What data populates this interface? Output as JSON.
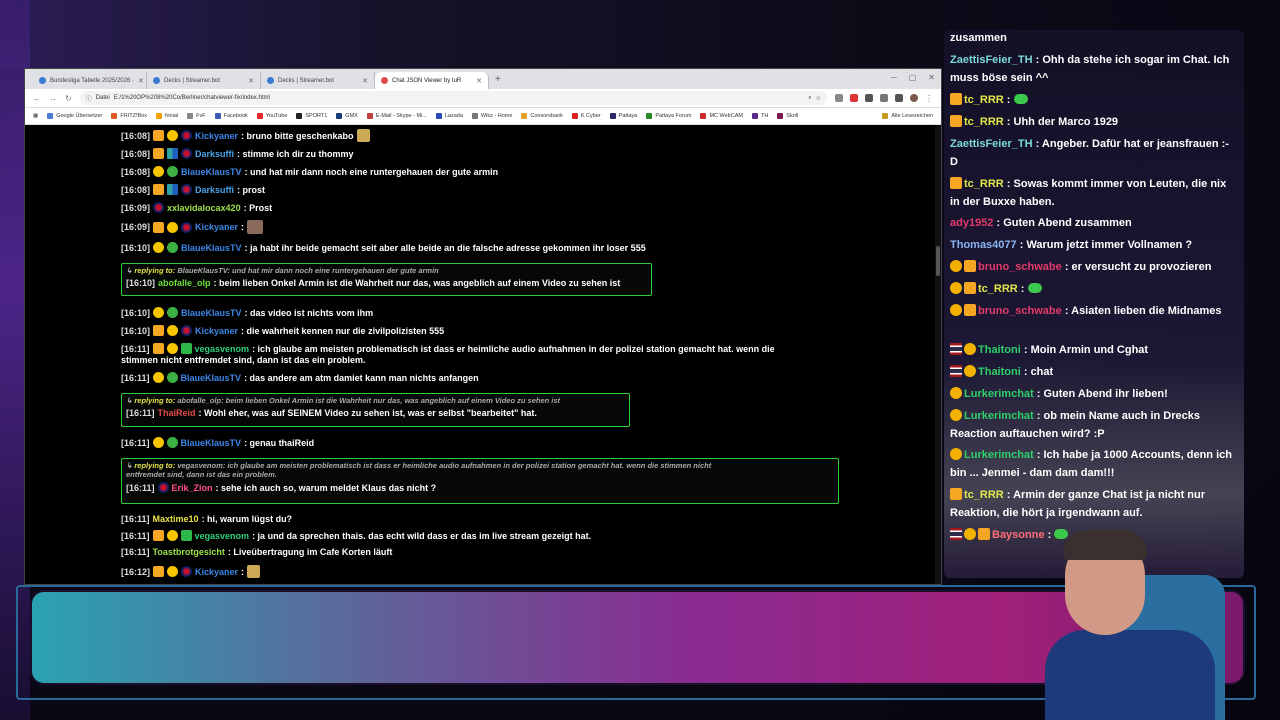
{
  "browser": {
    "tabs": [
      {
        "label": "Bundesliga Tabelle 2025/2026 ·"
      },
      {
        "label": "Decks | Streamer.bot"
      },
      {
        "label": "Decks | Streamer.bot"
      },
      {
        "label": "Chat JSON Viewer by tuR"
      }
    ],
    "new_tab": "+",
    "url_prefix": "Datei",
    "url": "E:/1%20OP%208%20Co/Berliner/chatviewer-fix/index.html",
    "bookmarks": [
      {
        "label": "Google Übersetzer"
      },
      {
        "label": "FRITZ!Box"
      },
      {
        "label": "fonial"
      },
      {
        "label": "FvF"
      },
      {
        "label": "Facebook"
      },
      {
        "label": "YouTube"
      },
      {
        "label": "SPORT1"
      },
      {
        "label": "GMX"
      },
      {
        "label": "E-Mail - Skype - Mi..."
      },
      {
        "label": "Lazada"
      },
      {
        "label": "Wikz - Home"
      },
      {
        "label": "Consorsbank"
      },
      {
        "label": "K Cyber"
      },
      {
        "label": "Pattaya"
      },
      {
        "label": "Pattaya Forum"
      },
      {
        "label": "MC WebCAM"
      },
      {
        "label": "TH"
      },
      {
        "label": "Skrill"
      }
    ],
    "bookmarks_right": "Alle Lesezeichen"
  },
  "chat": [
    {
      "ts": "[16:08]",
      "user": "Kickyaner",
      "text": ": bruno bitte geschenkabo"
    },
    {
      "ts": "[16:08]",
      "user": "Darksuffi",
      "text": ": stimme ich dir zu thommy"
    },
    {
      "ts": "[16:08]",
      "user": "BlaueKlausTV",
      "text": ": und hat mir dann noch eine runtergehauen der gute armin"
    },
    {
      "ts": "[16:08]",
      "user": "Darksuffi",
      "text": ": prost"
    },
    {
      "ts": "[16:09]",
      "user": "xxlavidalocax420",
      "text": ": Prost"
    },
    {
      "ts": "[16:09]",
      "user": "Kickyaner",
      "text": ":"
    },
    {
      "ts": "[16:10]",
      "user": "BlaueKlausTV",
      "text": ": ja habt ihr beide gemacht seit aber alle beide an die falsche adresse gekommen ihr loser 555"
    },
    {
      "ts": "[16:10]",
      "user": "BlaueKlausTV",
      "text": ": das video ist nichts vom ihm"
    },
    {
      "ts": "[16:10]",
      "user": "Kickyaner",
      "text": ": die wahrheit kennen nur die zivilpolizisten 555"
    },
    {
      "ts": "[16:11]",
      "user": "vegasvenom",
      "text": ": ich glaube am meisten problematisch ist dass er heimliche audio aufnahmen in der polizei station gemacht hat. wenn die",
      "text2": "stimmen nicht entfremdet sind, dann ist das ein problem."
    },
    {
      "ts": "[16:11]",
      "user": "BlaueKlausTV",
      "text": ": das andere am atm damiet kann man nichts anfangen"
    },
    {
      "ts": "[16:11]",
      "user": "BlaueKlausTV",
      "text": ": genau thaiReid"
    },
    {
      "ts": "[16:11]",
      "user": "Maxtime10",
      "text": ": hi, warum lügst du?"
    },
    {
      "ts": "[16:11]",
      "user": "vegasvenom",
      "text": ": ja und da sprechen thais. das echt wild dass er das im live stream gezeigt hat."
    },
    {
      "ts": "[16:11]",
      "user": "Toastbrotgesicht",
      "text": ": Liveübertragung im Cafe Korten läuft"
    },
    {
      "ts": "[16:12]",
      "user": "Kickyaner",
      "text": ":"
    }
  ],
  "replies": [
    {
      "label": "replying to:",
      "ref": "BlaueKlausTV: und hat mir dann noch eine runtergehauen der gute armin",
      "ts": "[16:10]",
      "user": "abofalle_olp",
      "text": ": beim lieben Onkel Armin ist die Wahrheit nur das, was angeblich auf einem Video zu sehen ist"
    },
    {
      "label": "replying to:",
      "ref": "abofalle_olp: beim lieben Onkel Armin ist die Wahrheit nur das, was angeblich auf einem Video zu sehen ist",
      "ts": "[16:11]",
      "user": "ThaiReid",
      "text": ": Wohl eher, was auf SEINEM Video zu sehen ist, was er selbst \"bearbeitet\" hat."
    },
    {
      "label": "replying to:",
      "ref": "vegasvenom: ich glaube am meisten problematisch ist dass er heimliche audio aufnahmen in der polizei station gemacht hat. wenn die stimmen nicht",
      "ref2": "entfremdet sind, dann ist das ein problem.",
      "ts": "[16:11]",
      "user": "Erik_Zion",
      "text": ": sehe ich auch so, warum meldet Klaus das nicht ?"
    }
  ],
  "overlay_chat": [
    {
      "user": "",
      "text": "zusammen"
    },
    {
      "user": "ZaettisFeier_TH",
      "text": ": Ohh da stehe ich sogar im Chat. Ich muss böse sein ^^"
    },
    {
      "user": "tc_RRR",
      "text": ":"
    },
    {
      "user": "tc_RRR",
      "text": ": Uhh der Marco 1929"
    },
    {
      "user": "ZaettisFeier_TH",
      "text": ": Angeber. Dafür hat er jeansfrauen :-D"
    },
    {
      "user": "tc_RRR",
      "text": ": Sowas kommt immer von Leuten, die nix in der Buxxe haben."
    },
    {
      "user": "ady1952",
      "text": ": Guten Abend zusammen"
    },
    {
      "user": "Thomas4077",
      "text": ": Warum jetzt immer Vollnamen ?"
    },
    {
      "user": "bruno_schwabe",
      "text": ": er versucht zu provozieren"
    },
    {
      "user": "tc_RRR",
      "text": ":"
    },
    {
      "user": "bruno_schwabe",
      "text": ": Asiaten lieben die Midnames"
    },
    {
      "user": "Thaitoni",
      "text": ": Moin Armin und Cghat"
    },
    {
      "user": "Thaitoni",
      "text": ": chat"
    },
    {
      "user": "Lurkerimchat",
      "text": ": Guten Abend ihr lieben!"
    },
    {
      "user": "Lurkerimchat",
      "text": ": ob mein Name auch in Drecks Reaction auftauchen wird? :P"
    },
    {
      "user": "Lurkerimchat",
      "text": ": Ich habe ja 1000 Accounts, denn ich bin ... Jenmei - dam dam dam!!!"
    },
    {
      "user": "tc_RRR",
      "text": ": Armin der ganze Chat ist ja nicht nur Reaktion, die hört ja irgendwann auf."
    },
    {
      "user": "Baysonne",
      "text": ":"
    }
  ]
}
